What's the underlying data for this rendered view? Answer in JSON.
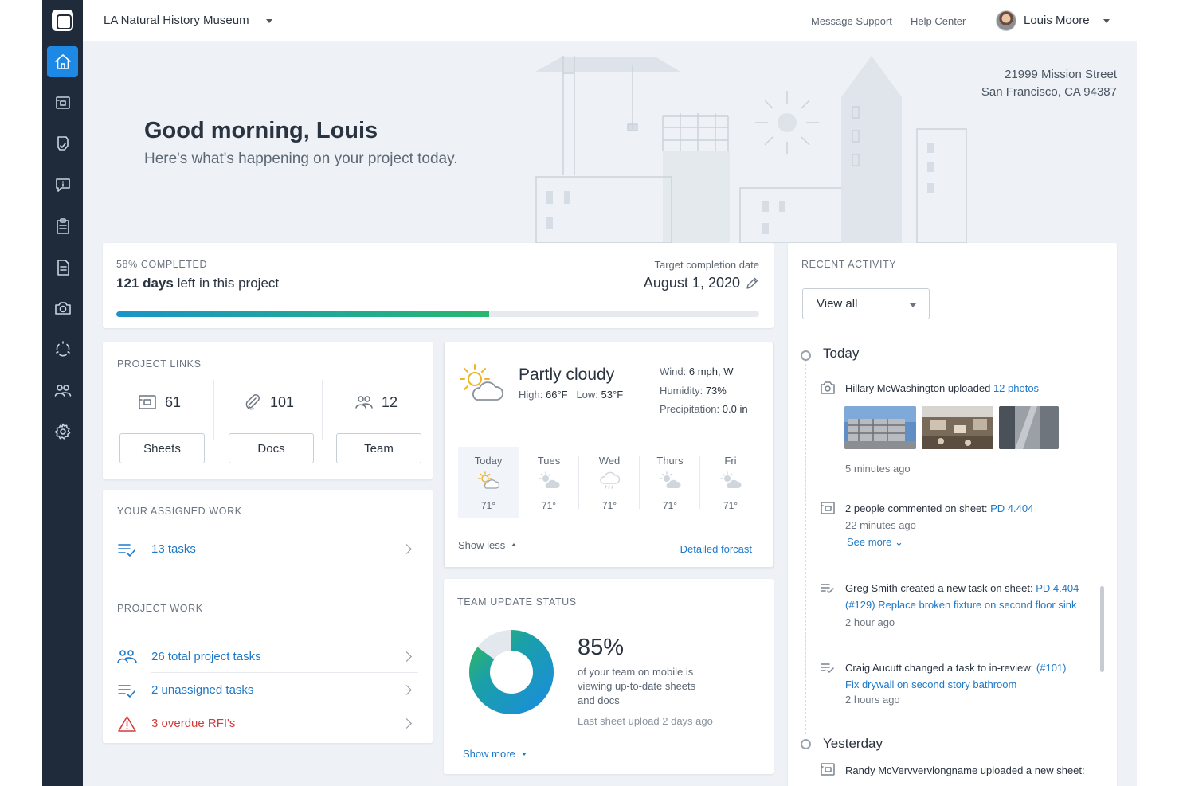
{
  "topbar": {
    "project_name": "LA Natural History Museum",
    "links": [
      "Message Support",
      "Help Center"
    ],
    "user_name": "Louis Moore"
  },
  "hero": {
    "greeting": "Good morning, Louis",
    "subtitle": "Here's what's happening on your project today.",
    "address_line1": "21999 Mission Street",
    "address_line2": "San Francisco, CA 94387"
  },
  "progress": {
    "completed_label": "58% COMPLETED",
    "percent": 58,
    "days_bold": "121 days",
    "days_rest": " left in this project",
    "target_label": "Target completion date",
    "target_date": "August 1, 2020"
  },
  "project_links": {
    "label": "PROJECT LINKS",
    "items": [
      {
        "count": "61",
        "button": "Sheets",
        "icon": "sheets-icon"
      },
      {
        "count": "101",
        "button": "Docs",
        "icon": "paperclip-icon"
      },
      {
        "count": "12",
        "button": "Team",
        "icon": "team-icon"
      }
    ]
  },
  "assigned_work": {
    "label": "YOUR ASSIGNED WORK",
    "tasks": "13 tasks"
  },
  "project_work": {
    "label": "PROJECT WORK",
    "items": [
      {
        "text": "26 total project tasks",
        "icon": "team-icon"
      },
      {
        "text": "2 unassigned tasks",
        "icon": "task-list-icon"
      },
      {
        "text": "3 overdue RFI's",
        "icon": "warning-icon"
      }
    ]
  },
  "weather": {
    "condition": "Partly cloudy",
    "high_label": "High:",
    "high": "66°F",
    "low_label": "Low:",
    "low": "53°F",
    "wind_label": "Wind:",
    "wind": "6 mph, W",
    "humidity_label": "Humidity:",
    "humidity": "73%",
    "precip_label": "Precipitation:",
    "precip": "0.0 in",
    "days": [
      {
        "name": "Today",
        "temp": "71°",
        "icon": "partly-cloudy-icon"
      },
      {
        "name": "Tues",
        "temp": "71°",
        "icon": "partly-cloudy-icon"
      },
      {
        "name": "Wed",
        "temp": "71°",
        "icon": "rain-icon"
      },
      {
        "name": "Thurs",
        "temp": "71°",
        "icon": "partly-cloudy-icon"
      },
      {
        "name": "Fri",
        "temp": "71°",
        "icon": "partly-cloudy-icon"
      }
    ],
    "show_less": "Show less",
    "detailed": "Detailed forcast"
  },
  "team_status": {
    "label": "TEAM UPDATE STATUS",
    "percent_text": "85%",
    "percent": 85,
    "description": "of your team on mobile is viewing up-to-date sheets and docs",
    "last_upload": "Last sheet upload 2 days ago",
    "show_more": "Show more",
    "colors": {
      "blue": "#1b8fd6",
      "green": "#2db36b",
      "gray": "#e3e8ee"
    }
  },
  "activity": {
    "label": "RECENT ACTIVITY",
    "filter": "View all",
    "today": "Today",
    "yesterday": "Yesterday",
    "items": [
      {
        "pre": "Hillary McWashington uploaded ",
        "link": "12 photos",
        "time": "5 minutes ago",
        "icon": "camera-icon"
      },
      {
        "pre": "2 people commented on sheet: ",
        "link": "PD 4.404",
        "time": "22 minutes ago",
        "see_more": "See more",
        "icon": "sheet-icon"
      },
      {
        "pre": "Greg Smith created a new task on sheet: ",
        "link": "PD 4.404",
        "link2": "(#129) Replace broken fixture on second floor sink",
        "time": "2 hour ago",
        "icon": "task-icon"
      },
      {
        "pre": "Craig Aucutt changed a task to in-review: ",
        "link": "(#101)",
        "link2": "Fix drywall on second story bathroom",
        "time": "2 hours ago",
        "icon": "task-icon"
      },
      {
        "pre": "Randy McVervvervlongname uploaded a new sheet:",
        "icon": "sheet-icon"
      }
    ]
  },
  "colors": {
    "sidebar": "#1f2b3a",
    "accent": "#1e88e5",
    "link": "#1e78c8",
    "danger": "#d23b3b"
  }
}
